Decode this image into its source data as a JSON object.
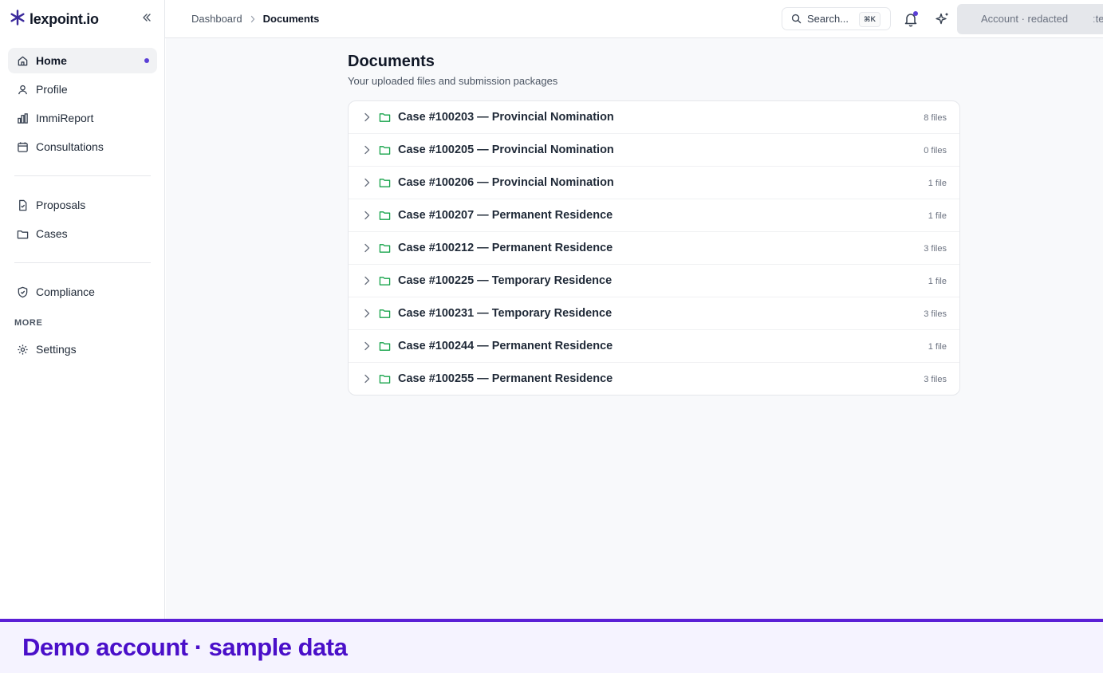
{
  "brand": {
    "name": "lexpoint.io"
  },
  "sidebar": {
    "items": [
      {
        "label": "Home",
        "icon": "home-icon",
        "active": true
      },
      {
        "label": "Profile",
        "icon": "user-icon"
      },
      {
        "label": "ImmiReport",
        "icon": "bar-chart-icon"
      },
      {
        "label": "Consultations",
        "icon": "calendar-icon"
      },
      {
        "label": "Proposals",
        "icon": "file-check-icon"
      },
      {
        "label": "Cases",
        "icon": "folder-icon"
      },
      {
        "label": "Compliance",
        "icon": "shield-check-icon"
      },
      {
        "label": "Settings",
        "icon": "gear-icon"
      }
    ],
    "section_more": "MORE"
  },
  "topbar": {
    "breadcrumb": {
      "parent": "Dashboard",
      "current": "Documents"
    },
    "search": {
      "placeholder": "Search...",
      "shortcut": "⌘K"
    },
    "account": {
      "label": "Account · redacted",
      "trail": "ːte"
    }
  },
  "page": {
    "title": "Documents",
    "subtitle": "Your uploaded files and submission packages"
  },
  "cases": [
    {
      "title": "Case #100203 — Provincial Nomination",
      "count": "8 files"
    },
    {
      "title": "Case #100205 — Provincial Nomination",
      "count": "0 files"
    },
    {
      "title": "Case #100206 — Provincial Nomination",
      "count": "1 file"
    },
    {
      "title": "Case #100207 — Permanent Residence",
      "count": "1 file"
    },
    {
      "title": "Case #100212 — Permanent Residence",
      "count": "3 files"
    },
    {
      "title": "Case #100225 — Temporary Residence",
      "count": "1 file"
    },
    {
      "title": "Case #100231 — Temporary Residence",
      "count": "3 files"
    },
    {
      "title": "Case #100244 — Permanent Residence",
      "count": "1 file"
    },
    {
      "title": "Case #100255 — Permanent Residence",
      "count": "3 files"
    }
  ],
  "demo_banner": {
    "text": "Demo account · sample data"
  },
  "colors": {
    "accent": "#5b3fd6",
    "folder": "#16a34a",
    "banner_text": "#4a0fc9"
  }
}
